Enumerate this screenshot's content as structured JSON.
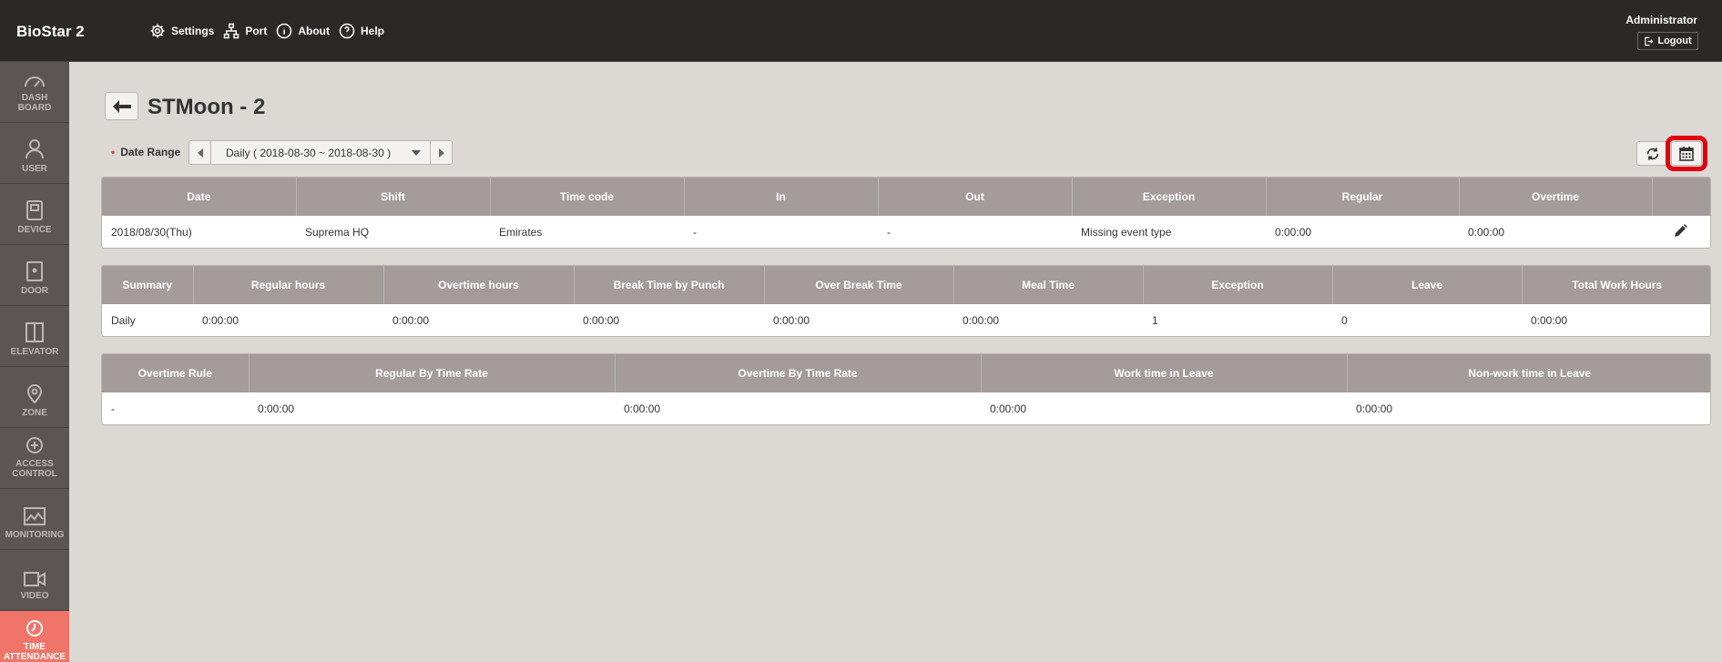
{
  "app": {
    "brand": "BioStar 2"
  },
  "topnav": [
    {
      "label": "Settings",
      "icon": "gear-icon"
    },
    {
      "label": "Port",
      "icon": "network-icon"
    },
    {
      "label": "About",
      "icon": "info-icon"
    },
    {
      "label": "Help",
      "icon": "help-icon"
    }
  ],
  "user": {
    "name": "Administrator",
    "logout": "Logout"
  },
  "sidebar": [
    {
      "label1": "DASH",
      "label2": "BOARD",
      "icon": "dashboard-icon"
    },
    {
      "label1": "USER",
      "label2": "",
      "icon": "user-icon"
    },
    {
      "label1": "DEVICE",
      "label2": "",
      "icon": "device-icon"
    },
    {
      "label1": "DOOR",
      "label2": "",
      "icon": "door-icon"
    },
    {
      "label1": "ELEVATOR",
      "label2": "",
      "icon": "elevator-icon"
    },
    {
      "label1": "ZONE",
      "label2": "",
      "icon": "zone-icon"
    },
    {
      "label1": "ACCESS",
      "label2": "CONTROL",
      "icon": "access-control-icon"
    },
    {
      "label1": "MONITORING",
      "label2": "",
      "icon": "monitoring-icon"
    },
    {
      "label1": "VIDEO",
      "label2": "",
      "icon": "video-icon"
    },
    {
      "label1": "TIME",
      "label2": "ATTENDANCE",
      "icon": "clock-icon",
      "active": true
    }
  ],
  "page": {
    "title": "STMoon - 2"
  },
  "filter": {
    "date_range_label": "Date Range",
    "date_range_value": "Daily ( 2018-08-30 ~ 2018-08-30 )"
  },
  "table1": {
    "headers": [
      "Date",
      "Shift",
      "Time code",
      "In",
      "Out",
      "Exception",
      "Regular",
      "Overtime",
      ""
    ],
    "rows": [
      [
        "2018/08/30(Thu)",
        "Suprema HQ",
        "Emirates",
        "-",
        "-",
        "Missing event type",
        "0:00:00",
        "0:00:00"
      ]
    ]
  },
  "table2": {
    "headers": [
      "Summary",
      "Regular hours",
      "Overtime hours",
      "Break Time by Punch",
      "Over Break Time",
      "Meal Time",
      "Exception",
      "Leave",
      "Total Work Hours"
    ],
    "rows": [
      [
        "Daily",
        "0:00:00",
        "0:00:00",
        "0:00:00",
        "0:00:00",
        "0:00:00",
        "1",
        "0",
        "0:00:00"
      ]
    ]
  },
  "table3": {
    "headers": [
      "Overtime Rule",
      "Regular By Time Rate",
      "Overtime By Time Rate",
      "Work time in Leave",
      "Non-work time in Leave"
    ],
    "rows": [
      [
        "-",
        "0:00:00",
        "0:00:00",
        "0:00:00",
        "0:00:00"
      ]
    ]
  }
}
